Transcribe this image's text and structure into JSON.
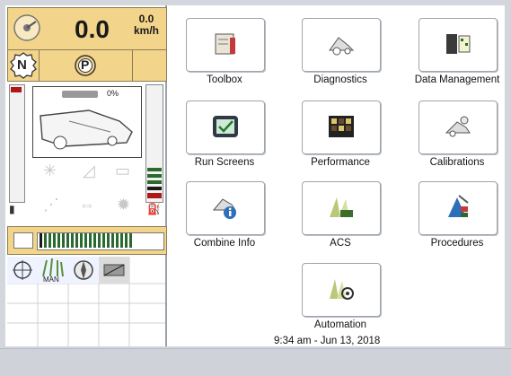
{
  "status_panel": {
    "speed_value": "0.0",
    "speed_secondary": "0.0",
    "speed_unit": "km/h",
    "gear": "N",
    "park": "P",
    "header_percent": "0%",
    "mode_label": "MAN"
  },
  "apps": [
    {
      "label": "Toolbox",
      "icon": "toolbox-icon"
    },
    {
      "label": "Diagnostics",
      "icon": "diagnostics-icon"
    },
    {
      "label": "Data Management",
      "icon": "data-management-icon"
    },
    {
      "label": "Run Screens",
      "icon": "run-screens-icon"
    },
    {
      "label": "Performance",
      "icon": "performance-icon"
    },
    {
      "label": "Calibrations",
      "icon": "calibrations-icon"
    },
    {
      "label": "Combine Info",
      "icon": "combine-info-icon"
    },
    {
      "label": "ACS",
      "icon": "acs-icon"
    },
    {
      "label": "Procedures",
      "icon": "procedures-icon"
    },
    {
      "label": "Automation",
      "icon": "automation-icon"
    }
  ],
  "footer": {
    "datetime": "9:34 am - Jun 13, 2018"
  },
  "colors": {
    "amber_panel": "#f2d48b",
    "gauge_green": "#2a6a30",
    "gauge_red": "#b01818"
  }
}
